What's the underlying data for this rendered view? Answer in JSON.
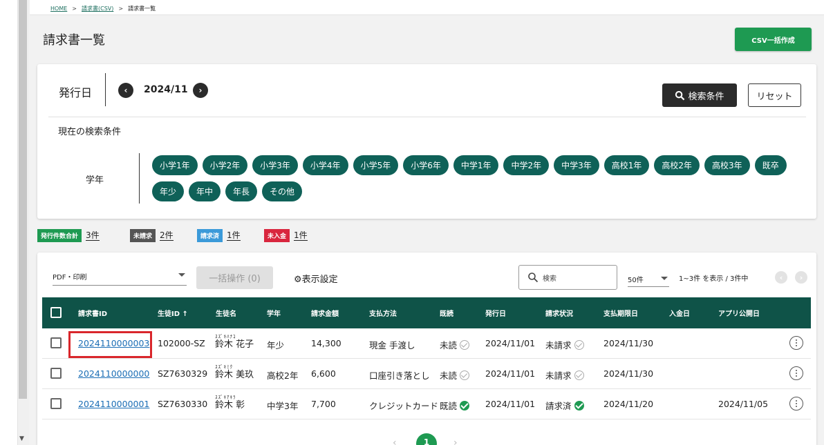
{
  "breadcrumb": {
    "home": "HOME",
    "parent": "請求書(CSV)",
    "current": "請求書一覧",
    "sep": ">"
  },
  "header": {
    "title": "請求書一覧",
    "csv_button": "CSV一括作成"
  },
  "filter": {
    "issue_label": "発行日",
    "month": "2024/11",
    "prev": "‹",
    "next": "›",
    "search_button": "検索条件",
    "reset_button": "リセット",
    "current_conditions": "現在の検索条件",
    "grade_label": "学年",
    "grades": [
      "小学1年",
      "小学2年",
      "小学3年",
      "小学4年",
      "小学5年",
      "小学6年",
      "中学1年",
      "中学2年",
      "中学3年",
      "高校1年",
      "高校2年",
      "高校3年",
      "既卒",
      "年少",
      "年中",
      "年長",
      "その他"
    ]
  },
  "summary": [
    {
      "label": "発行件数合計",
      "count": "3件",
      "color": "#1e9a52"
    },
    {
      "label": "未請求",
      "count": "2件",
      "color": "#555555"
    },
    {
      "label": "請求済",
      "count": "1件",
      "color": "#3b9ad9"
    },
    {
      "label": "未入金",
      "count": "1件",
      "color": "#d9263e"
    }
  ],
  "toolbar": {
    "pdf_select": "PDF・印刷",
    "bulk_button": "一括操作 (0)",
    "display_settings": "表示設定",
    "search_placeholder": "検索",
    "per_page": "50件",
    "range": "1~3件 を表示 / 3件中"
  },
  "table": {
    "headers": [
      "請求書ID",
      "生徒ID ↑",
      "生徒名",
      "学年",
      "請求金額",
      "支払方法",
      "既読",
      "発行日",
      "請求状況",
      "支払期限日",
      "入金日",
      "アプリ公開日"
    ],
    "rows": [
      {
        "invoice_id": "2024110000003",
        "student_id": "102000-SZ",
        "kana": "ｽｽﾞｷﾊﾅｺ",
        "name": "鈴木 花子",
        "grade": "年少",
        "amount": "14,300",
        "payment": "現金 手渡し",
        "read": "未読",
        "read_ok": false,
        "issued": "2024/11/01",
        "status": "未請求",
        "status_ok": false,
        "due": "2024/11/30",
        "paid": "",
        "app_date": ""
      },
      {
        "invoice_id": "2024110000000",
        "student_id": "SZ7630329",
        "kana": "ｽｽﾞｷﾐｸ",
        "name": "鈴木 美玖",
        "grade": "高校2年",
        "amount": "6,600",
        "payment": "口座引き落とし",
        "read": "未読",
        "read_ok": false,
        "issued": "2024/11/01",
        "status": "未請求",
        "status_ok": false,
        "due": "2024/11/30",
        "paid": "",
        "app_date": ""
      },
      {
        "invoice_id": "2024110000001",
        "student_id": "SZ7630330",
        "kana": "ｽｽﾞｷｱｷﾗ",
        "name": "鈴木 彰",
        "grade": "中学3年",
        "amount": "7,700",
        "payment": "クレジットカード",
        "read": "既読",
        "read_ok": true,
        "issued": "2024/11/01",
        "status": "請求済",
        "status_ok": true,
        "due": "2024/11/20",
        "paid": "",
        "app_date": "2024/11/05"
      }
    ]
  },
  "pagination": {
    "current": "1",
    "prev": "‹",
    "next": "›"
  }
}
